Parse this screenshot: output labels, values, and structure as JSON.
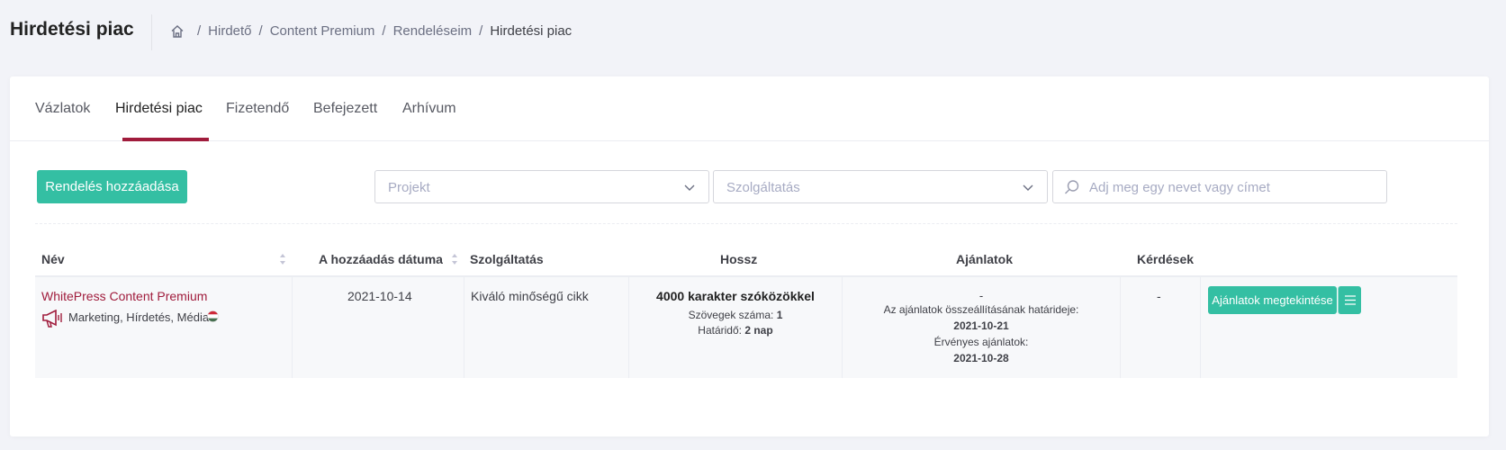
{
  "header": {
    "title": "Hirdetési piac",
    "breadcrumb": [
      "Hirdető",
      "Content Premium",
      "Rendeléseim",
      "Hirdetési piac"
    ]
  },
  "tabs": [
    {
      "label": "Vázlatok"
    },
    {
      "label": "Hirdetési piac"
    },
    {
      "label": "Fizetendő"
    },
    {
      "label": "Befejezett"
    },
    {
      "label": "Arhívum"
    }
  ],
  "toolbar": {
    "add_label": "Rendelés hozzáadása",
    "project_placeholder": "Projekt",
    "service_placeholder": "Szolgáltatás",
    "search_placeholder": "Adj meg egy nevet vagy címet"
  },
  "table": {
    "headers": [
      "Név",
      "A hozzáadás dátuma",
      "Szolgáltatás",
      "Hossz",
      "Ajánlatok",
      "Kérdések"
    ],
    "rows": [
      {
        "name": "WhitePress Content Premium",
        "category": "Marketing, Hírdetés, Média",
        "date": "2021-10-14",
        "service": "Kiváló minőségű cikk",
        "length_title": "4000 karakter szóközökkel",
        "texts_label": "Szövegek száma:",
        "texts_value": "1",
        "deadline_label": "Határidő:",
        "deadline_value": "2 nap",
        "offers_dash": "-",
        "offers_deadline_label": "Az ajánlatok összeállításának határideje:",
        "offers_deadline_value": "2021-10-21",
        "valid_offers_label": "Érvényes ajánlatok:",
        "valid_offers_value": "2021-10-28",
        "questions": "-",
        "action_label": "Ajánlatok megtekintése"
      }
    ]
  },
  "colors": {
    "accent": "#34bfa3",
    "brand": "#a01c3c"
  }
}
